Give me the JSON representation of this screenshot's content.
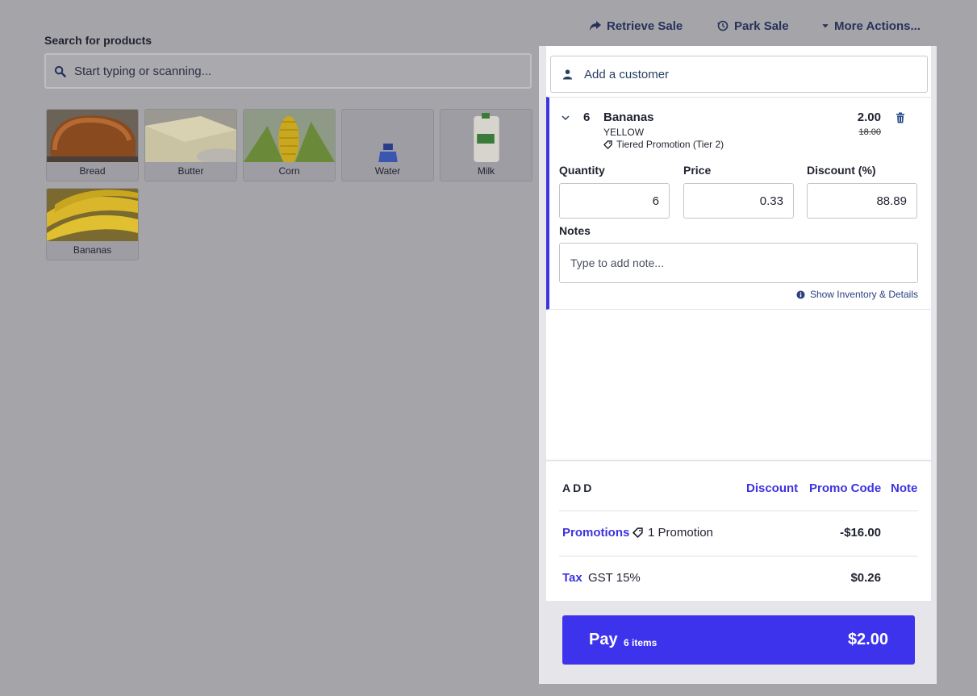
{
  "top_actions": {
    "retrieve_sale": "Retrieve Sale",
    "park_sale": "Park Sale",
    "more_actions": "More Actions..."
  },
  "search": {
    "label": "Search for products",
    "placeholder": "Start typing or scanning..."
  },
  "products": [
    {
      "label": "Bread"
    },
    {
      "label": "Butter"
    },
    {
      "label": "Corn"
    },
    {
      "label": "Water"
    },
    {
      "label": "Milk"
    },
    {
      "label": "Bananas"
    }
  ],
  "customer": {
    "placeholder": "Add a customer"
  },
  "line_item": {
    "quantity": "6",
    "name": "Bananas",
    "variant": "YELLOW",
    "promotion": "Tiered Promotion (Tier 2)",
    "price": "2.00",
    "original_price": "18.00",
    "fields": {
      "quantity_label": "Quantity",
      "quantity_value": "6",
      "price_label": "Price",
      "price_value": "0.33",
      "discount_label": "Discount (%)",
      "discount_value": "88.89"
    },
    "notes_label": "Notes",
    "notes_placeholder": "Type to add note...",
    "show_inventory": "Show Inventory & Details"
  },
  "add": {
    "label": "ADD",
    "discount": "Discount",
    "promo_code": "Promo Code",
    "note": "Note"
  },
  "summary": {
    "promotions_label": "Promotions",
    "promotions_desc": "1 Promotion",
    "promotions_amount": "-$16.00",
    "tax_label": "Tax",
    "tax_desc": "GST 15%",
    "tax_amount": "$0.26"
  },
  "pay": {
    "label": "Pay",
    "items": "6 items",
    "total": "$2.00"
  },
  "colors": {
    "accent": "#3d33ec",
    "background": "#a5a4a9"
  }
}
